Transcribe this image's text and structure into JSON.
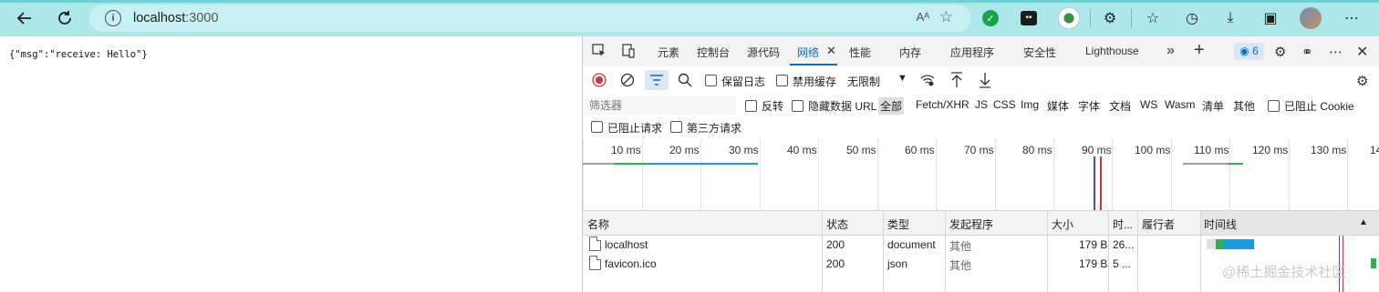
{
  "browser": {
    "url_host": "localhost",
    "url_port": ":3000",
    "read_aloud": "Aᴬ"
  },
  "page": {
    "body_text": "{\"msg\":\"receive: Hello\"}"
  },
  "devtools": {
    "tabs": [
      "元素",
      "控制台",
      "源代码",
      "网络",
      "性能",
      "内存",
      "应用程序",
      "安全性",
      "Lighthouse"
    ],
    "active_tab": "网络",
    "issues_count": "6",
    "toolbar": {
      "preserve_log": "保留日志",
      "disable_cache": "禁用缓存",
      "throttling": "无限制"
    },
    "filter": {
      "placeholder": "筛选器",
      "invert": "反转",
      "hide_data_urls": "隐藏数据 URL",
      "types": [
        "全部",
        "Fetch/XHR",
        "JS",
        "CSS",
        "Img",
        "媒体",
        "字体",
        "文档",
        "WS",
        "Wasm",
        "清单",
        "其他"
      ],
      "blocked_cookies": "已阻止 Cookie",
      "blocked_requests": "已阻止请求",
      "third_party": "第三方请求"
    },
    "overview_ticks": [
      "10 ms",
      "20 ms",
      "30 ms",
      "40 ms",
      "50 ms",
      "60 ms",
      "70 ms",
      "80 ms",
      "90 ms",
      "100 ms",
      "110 ms",
      "120 ms",
      "130 ms",
      "14"
    ],
    "columns": [
      "名称",
      "状态",
      "类型",
      "发起程序",
      "大小",
      "时...",
      "履行者",
      "时间线"
    ],
    "sort_indicator": "▲",
    "rows": [
      {
        "name": "localhost",
        "status": "200",
        "type": "document",
        "initiator": "其他",
        "size": "179 B",
        "time": "26..."
      },
      {
        "name": "favicon.ico",
        "status": "200",
        "type": "json",
        "initiator": "其他",
        "size": "179 B",
        "time": "5 ..."
      }
    ]
  },
  "watermark": "@稀土掘金技术社区",
  "colors": {
    "chrome_bg": "#ace7e9",
    "accent_blue": "#0f6cbd",
    "record_red": "#d13438",
    "waterfall_blue": "#1a9be0",
    "waterfall_green": "#2bb24c"
  }
}
